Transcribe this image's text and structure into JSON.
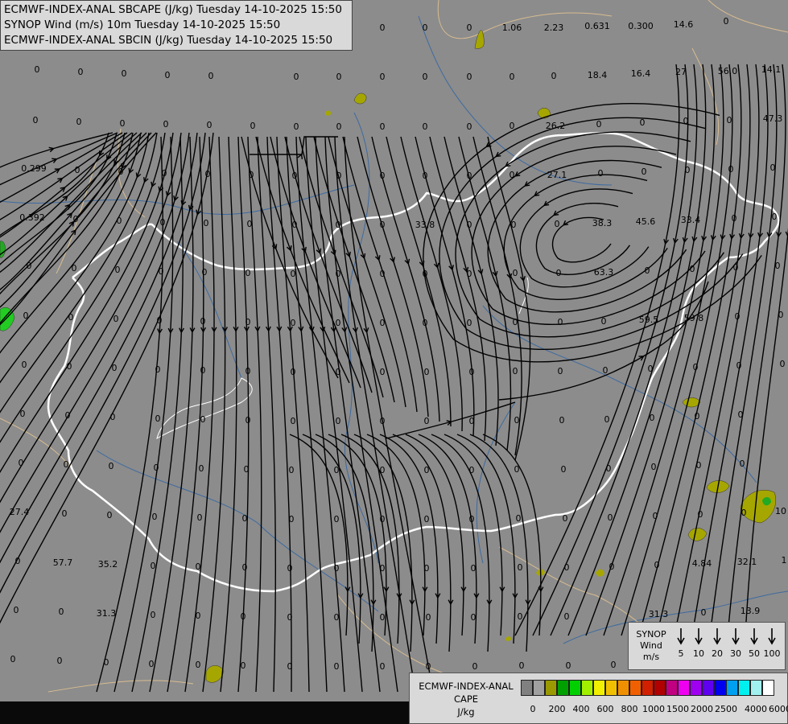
{
  "header": {
    "line1": "ECMWF-INDEX-ANAL SBCAPE (J/kg) Tuesday 14-10-2025 15:50",
    "line2": "SYNOP Wind (m/s) 10m Tuesday 14-10-2025 15:50",
    "line3": "ECMWF-INDEX-ANAL SBCIN (J/kg) Tuesday 14-10-2025 15:50"
  },
  "wind_legend": {
    "title_lines": [
      "SYNOP",
      "Wind",
      "m/s"
    ],
    "items": [
      "5",
      "10",
      "20",
      "30",
      "50",
      "100"
    ]
  },
  "cape_legend": {
    "title_lines": [
      "ECMWF-INDEX-ANAL",
      "CAPE",
      "J/kg"
    ],
    "ticks": [
      "0",
      "200",
      "400",
      "600",
      "800",
      "1000",
      "1500",
      "2000",
      "2500",
      "4000",
      "6000"
    ],
    "colors": [
      "#808080",
      "#a0a0a0",
      "#9a9a00",
      "#00a000",
      "#00d000",
      "#a0f000",
      "#f0f000",
      "#f0c000",
      "#f09000",
      "#f06000",
      "#d02000",
      "#b00000",
      "#c00080",
      "#f000f0",
      "#a000f0",
      "#6000f0",
      "#0000f0",
      "#00a0f0",
      "#00f0f0",
      "#a0f0f0",
      "#ffffff"
    ]
  },
  "map_values": [
    [
      "0",
      475,
      38
    ],
    [
      "0",
      528,
      38
    ],
    [
      "0",
      583,
      38
    ],
    [
      "1.06",
      636,
      38
    ],
    [
      "2.23",
      688,
      38
    ],
    [
      "0.631",
      742,
      36
    ],
    [
      "0.300",
      796,
      36
    ],
    [
      "14.6",
      849,
      34
    ],
    [
      "0",
      902,
      30
    ],
    [
      "0",
      46,
      90
    ],
    [
      "0",
      100,
      93
    ],
    [
      "0",
      154,
      95
    ],
    [
      "0",
      208,
      97
    ],
    [
      "0",
      262,
      98
    ],
    [
      "0",
      368,
      99
    ],
    [
      "0",
      421,
      99
    ],
    [
      "0",
      475,
      99
    ],
    [
      "0",
      528,
      99
    ],
    [
      "0",
      583,
      99
    ],
    [
      "0",
      636,
      99
    ],
    [
      "0",
      688,
      98
    ],
    [
      "18.4",
      742,
      97
    ],
    [
      "16.4",
      796,
      95
    ],
    [
      "27",
      846,
      93
    ],
    [
      "56.0",
      904,
      92
    ],
    [
      "14.1",
      958,
      90
    ],
    [
      "0",
      44,
      153
    ],
    [
      "0",
      98,
      155
    ],
    [
      "0",
      152,
      157
    ],
    [
      "0",
      206,
      158
    ],
    [
      "0",
      260,
      159
    ],
    [
      "0",
      314,
      160
    ],
    [
      "0",
      368,
      161
    ],
    [
      "0",
      421,
      161
    ],
    [
      "0",
      475,
      161
    ],
    [
      "0",
      528,
      161
    ],
    [
      "0",
      583,
      161
    ],
    [
      "0",
      636,
      160
    ],
    [
      "26.2",
      690,
      160
    ],
    [
      "0",
      744,
      158
    ],
    [
      "0",
      798,
      156
    ],
    [
      "0",
      852,
      154
    ],
    [
      "0",
      906,
      153
    ],
    [
      "47.3",
      960,
      151
    ],
    [
      "0.299",
      42,
      213
    ],
    [
      "0",
      96,
      215
    ],
    [
      "0",
      150,
      217
    ],
    [
      "0",
      204,
      219
    ],
    [
      "0",
      258,
      220
    ],
    [
      "0",
      312,
      221
    ],
    [
      "0",
      366,
      222
    ],
    [
      "0",
      421,
      222
    ],
    [
      "0",
      475,
      222
    ],
    [
      "0",
      528,
      222
    ],
    [
      "0",
      583,
      222
    ],
    [
      "0",
      636,
      221
    ],
    [
      "27.1",
      692,
      221
    ],
    [
      "0",
      746,
      219
    ],
    [
      "0",
      800,
      217
    ],
    [
      "0",
      854,
      215
    ],
    [
      "0",
      908,
      214
    ],
    [
      "0",
      960,
      212
    ],
    [
      "0.392",
      40,
      274
    ],
    [
      "0",
      94,
      276
    ],
    [
      "0",
      148,
      278
    ],
    [
      "0",
      202,
      280
    ],
    [
      "0",
      256,
      281
    ],
    [
      "0",
      310,
      282
    ],
    [
      "0",
      366,
      283
    ],
    [
      "0",
      420,
      283
    ],
    [
      "0",
      475,
      283
    ],
    [
      "33.8",
      528,
      283
    ],
    [
      "0",
      583,
      283
    ],
    [
      "0",
      638,
      283
    ],
    [
      "0",
      692,
      282
    ],
    [
      "38.3",
      748,
      281
    ],
    [
      "45.6",
      802,
      279
    ],
    [
      "33.4",
      858,
      277
    ],
    [
      "0",
      912,
      275
    ],
    [
      "0",
      962,
      273
    ],
    [
      "0",
      36,
      334
    ],
    [
      "0",
      92,
      337
    ],
    [
      "0",
      146,
      339
    ],
    [
      "0",
      200,
      341
    ],
    [
      "0",
      254,
      342
    ],
    [
      "0",
      308,
      343
    ],
    [
      "0",
      364,
      344
    ],
    [
      "0",
      420,
      344
    ],
    [
      "0",
      475,
      344
    ],
    [
      "0",
      528,
      344
    ],
    [
      "0",
      583,
      344
    ],
    [
      "0",
      640,
      343
    ],
    [
      "0",
      694,
      343
    ],
    [
      "63.3",
      750,
      342
    ],
    [
      "0",
      804,
      340
    ],
    [
      "0",
      860,
      338
    ],
    [
      "0",
      914,
      336
    ],
    [
      "0",
      966,
      334
    ],
    [
      "0",
      32,
      396
    ],
    [
      "0",
      88,
      398
    ],
    [
      "0",
      144,
      400
    ],
    [
      "0",
      198,
      402
    ],
    [
      "0",
      252,
      403
    ],
    [
      "0",
      308,
      404
    ],
    [
      "0",
      364,
      405
    ],
    [
      "0",
      420,
      405
    ],
    [
      "0",
      475,
      405
    ],
    [
      "0",
      528,
      405
    ],
    [
      "0",
      583,
      405
    ],
    [
      "0",
      640,
      404
    ],
    [
      "0",
      696,
      404
    ],
    [
      "0",
      750,
      403
    ],
    [
      "59.5",
      806,
      401
    ],
    [
      "59.8",
      862,
      399
    ],
    [
      "0",
      916,
      397
    ],
    [
      "0",
      970,
      395
    ],
    [
      "0",
      30,
      457
    ],
    [
      "0",
      86,
      459
    ],
    [
      "0",
      142,
      461
    ],
    [
      "0",
      196,
      463
    ],
    [
      "0",
      252,
      464
    ],
    [
      "0",
      308,
      465
    ],
    [
      "0",
      364,
      466
    ],
    [
      "0",
      420,
      466
    ],
    [
      "0",
      475,
      466
    ],
    [
      "0",
      530,
      466
    ],
    [
      "0",
      586,
      466
    ],
    [
      "0",
      640,
      465
    ],
    [
      "0",
      696,
      465
    ],
    [
      "0",
      752,
      464
    ],
    [
      "0",
      808,
      462
    ],
    [
      "0",
      864,
      460
    ],
    [
      "0",
      918,
      458
    ],
    [
      "0",
      972,
      456
    ],
    [
      "0",
      28,
      518
    ],
    [
      "0",
      84,
      520
    ],
    [
      "0",
      140,
      522
    ],
    [
      "0",
      196,
      524
    ],
    [
      "0",
      252,
      525
    ],
    [
      "0",
      308,
      526
    ],
    [
      "0",
      364,
      527
    ],
    [
      "0",
      420,
      527
    ],
    [
      "0",
      475,
      527
    ],
    [
      "0",
      530,
      527
    ],
    [
      "0",
      586,
      527
    ],
    [
      "0",
      642,
      526
    ],
    [
      "0",
      698,
      526
    ],
    [
      "0",
      754,
      525
    ],
    [
      "0",
      810,
      523
    ],
    [
      "0",
      866,
      521
    ],
    [
      "0",
      920,
      519
    ],
    [
      "0",
      26,
      579
    ],
    [
      "0",
      82,
      581
    ],
    [
      "0",
      138,
      583
    ],
    [
      "0",
      194,
      585
    ],
    [
      "0",
      250,
      586
    ],
    [
      "0",
      306,
      587
    ],
    [
      "0",
      362,
      588
    ],
    [
      "0",
      418,
      588
    ],
    [
      "0",
      475,
      588
    ],
    [
      "0",
      530,
      588
    ],
    [
      "0",
      586,
      588
    ],
    [
      "0",
      642,
      587
    ],
    [
      "0",
      700,
      587
    ],
    [
      "0",
      756,
      586
    ],
    [
      "0",
      812,
      584
    ],
    [
      "0",
      868,
      582
    ],
    [
      "0",
      922,
      580
    ],
    [
      "27.4",
      24,
      640
    ],
    [
      "0",
      80,
      642
    ],
    [
      "0",
      136,
      644
    ],
    [
      "0",
      192,
      646
    ],
    [
      "0",
      248,
      647
    ],
    [
      "0",
      304,
      648
    ],
    [
      "0",
      362,
      649
    ],
    [
      "0",
      418,
      649
    ],
    [
      "0",
      475,
      649
    ],
    [
      "0",
      530,
      649
    ],
    [
      "0",
      586,
      649
    ],
    [
      "0",
      644,
      648
    ],
    [
      "0",
      702,
      648
    ],
    [
      "0",
      758,
      647
    ],
    [
      "0",
      814,
      645
    ],
    [
      "0",
      870,
      643
    ],
    [
      "0",
      924,
      641
    ],
    [
      "10",
      970,
      639
    ],
    [
      "0",
      22,
      701
    ],
    [
      "57.7",
      78,
      703
    ],
    [
      "35.2",
      134,
      705
    ],
    [
      "0",
      190,
      707
    ],
    [
      "0",
      246,
      708
    ],
    [
      "0",
      304,
      709
    ],
    [
      "0",
      360,
      710
    ],
    [
      "0",
      418,
      710
    ],
    [
      "0",
      475,
      710
    ],
    [
      "0",
      530,
      710
    ],
    [
      "0",
      588,
      710
    ],
    [
      "0",
      646,
      709
    ],
    [
      "0",
      704,
      709
    ],
    [
      "0",
      760,
      708
    ],
    [
      "0",
      816,
      706
    ],
    [
      "4.84",
      872,
      704
    ],
    [
      "32.1",
      928,
      702
    ],
    [
      "1",
      974,
      700
    ],
    [
      "0",
      20,
      762
    ],
    [
      "0",
      76,
      764
    ],
    [
      "31.3",
      132,
      766
    ],
    [
      "0",
      190,
      768
    ],
    [
      "0",
      246,
      769
    ],
    [
      "0",
      302,
      770
    ],
    [
      "0",
      360,
      771
    ],
    [
      "0",
      418,
      771
    ],
    [
      "0",
      475,
      771
    ],
    [
      "0",
      532,
      771
    ],
    [
      "0",
      588,
      771
    ],
    [
      "0",
      646,
      770
    ],
    [
      "0",
      704,
      770
    ],
    [
      "31.3",
      818,
      767
    ],
    [
      "0",
      874,
      765
    ],
    [
      "13.9",
      932,
      763
    ],
    [
      "0",
      16,
      823
    ],
    [
      "0",
      74,
      825
    ],
    [
      "0",
      132,
      827
    ],
    [
      "0",
      188,
      829
    ],
    [
      "0",
      246,
      830
    ],
    [
      "0",
      302,
      831
    ],
    [
      "0",
      360,
      832
    ],
    [
      "0",
      418,
      832
    ],
    [
      "0",
      475,
      832
    ],
    [
      "0",
      532,
      832
    ],
    [
      "0",
      590,
      832
    ],
    [
      "0",
      648,
      831
    ],
    [
      "0",
      706,
      831
    ],
    [
      "0",
      762,
      830
    ],
    [
      "0",
      818,
      828
    ],
    [
      "0",
      874,
      826
    ],
    [
      "0",
      932,
      825
    ]
  ]
}
